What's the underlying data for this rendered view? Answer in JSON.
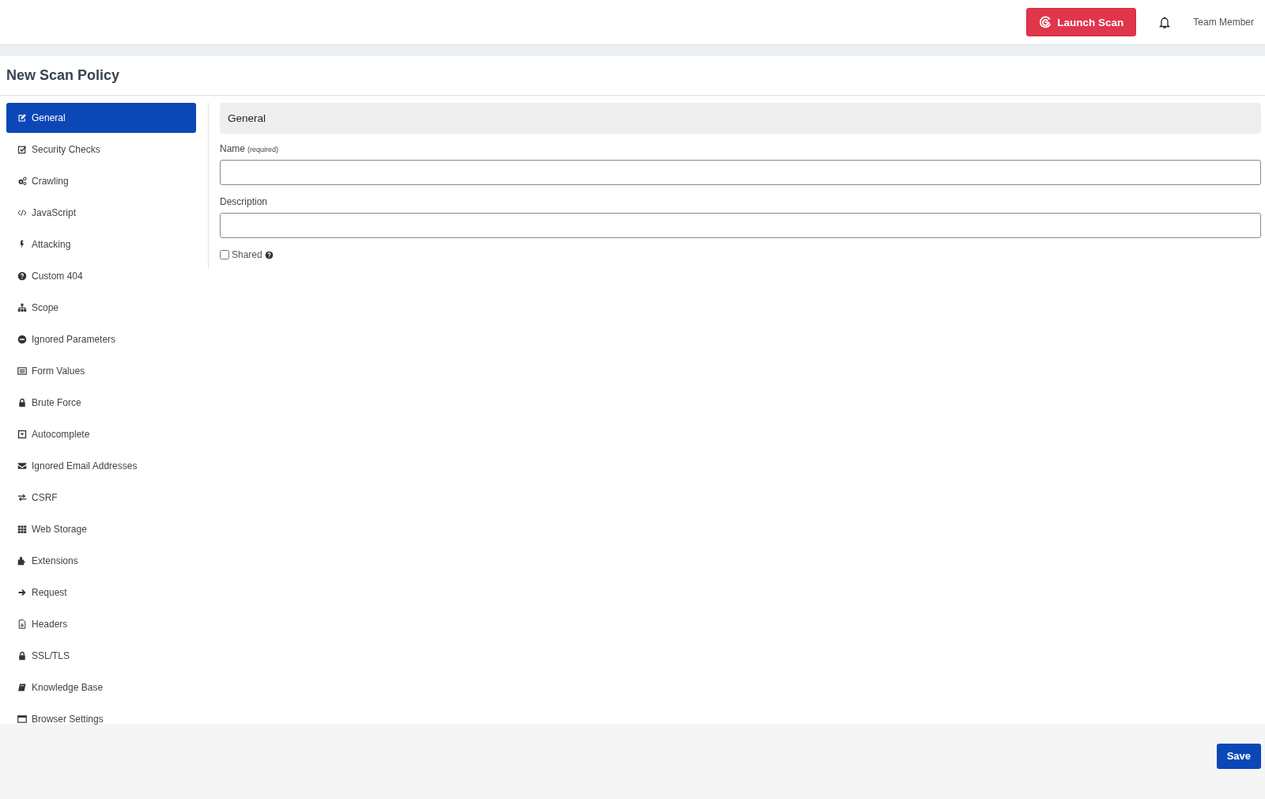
{
  "header": {
    "launch_button": "Launch Scan",
    "user": "Team Member"
  },
  "page": {
    "title": "New Scan Policy"
  },
  "sidebar": {
    "items": [
      {
        "label": "General",
        "selected": true
      },
      {
        "label": "Security Checks",
        "selected": false
      },
      {
        "label": "Crawling",
        "selected": false
      },
      {
        "label": "JavaScript",
        "selected": false
      },
      {
        "label": "Attacking",
        "selected": false
      },
      {
        "label": "Custom 404",
        "selected": false
      },
      {
        "label": "Scope",
        "selected": false
      },
      {
        "label": "Ignored Parameters",
        "selected": false
      },
      {
        "label": "Form Values",
        "selected": false
      },
      {
        "label": "Brute Force",
        "selected": false
      },
      {
        "label": "Autocomplete",
        "selected": false
      },
      {
        "label": "Ignored Email Addresses",
        "selected": false
      },
      {
        "label": "CSRF",
        "selected": false
      },
      {
        "label": "Web Storage",
        "selected": false
      },
      {
        "label": "Extensions",
        "selected": false
      },
      {
        "label": "Request",
        "selected": false
      },
      {
        "label": "Headers",
        "selected": false
      },
      {
        "label": "SSL/TLS",
        "selected": false
      },
      {
        "label": "Knowledge Base",
        "selected": false
      },
      {
        "label": "Browser Settings",
        "selected": false
      }
    ]
  },
  "panel": {
    "title": "General",
    "fields": [
      {
        "label": "Name",
        "hint": "(required)"
      },
      {
        "label": "Description"
      }
    ],
    "shared": {
      "label": "Shared",
      "checked": false
    }
  },
  "footer": {
    "save_button": "Save"
  }
}
